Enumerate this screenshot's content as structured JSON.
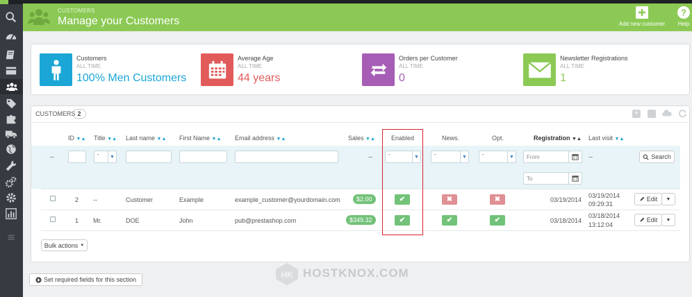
{
  "header": {
    "breadcrumb": "CUSTOMERS",
    "title": "Manage your Customers",
    "add_label": "Add new customer",
    "help_label": "Help"
  },
  "kpis": [
    {
      "label": "Customers",
      "period": "ALL TIME",
      "value": "100% Men Customers",
      "color": "#1ba6d6"
    },
    {
      "label": "Average Age",
      "period": "ALL TIME",
      "value": "44 years",
      "color": "#e15b5b"
    },
    {
      "label": "Orders per Customer",
      "period": "ALL TIME",
      "value": "0",
      "color": "#a55db5"
    },
    {
      "label": "Newsletter Registrations",
      "period": "ALL TIME",
      "value": "1",
      "color": "#8bc954"
    }
  ],
  "list": {
    "title": "CUSTOMERS",
    "count": "2",
    "columns": {
      "id": "ID",
      "title": "Title",
      "last_name": "Last name",
      "first_name": "First Name",
      "email": "Email address",
      "sales": "Sales",
      "enabled": "Enabled",
      "news": "News.",
      "opt": "Opt.",
      "registration": "Registration",
      "last_visit": "Last visit"
    },
    "filters": {
      "dash1": "--",
      "title_value": "-",
      "sales_dash": "--",
      "enabled_value": "-",
      "news_value": "-",
      "opt_value": "-",
      "from_placeholder": "From",
      "to_placeholder": "To",
      "last_visit_dash": "--",
      "search_label": "Search"
    },
    "rows": [
      {
        "id": "2",
        "title": "--",
        "last_name": "Customer",
        "first_name": "Example",
        "email": "example_customer@yourdomain.com",
        "sales": "$2.00",
        "enabled": true,
        "news": false,
        "opt": false,
        "registration": "03/19/2014",
        "last_visit_date": "03/19/2014",
        "last_visit_time": "09:29:31",
        "edit": "Edit"
      },
      {
        "id": "1",
        "title": "Mr.",
        "last_name": "DOE",
        "first_name": "John",
        "email": "pub@prestashop.com",
        "sales": "$349.32",
        "enabled": true,
        "news": true,
        "opt": true,
        "registration": "03/18/2014",
        "last_visit_date": "03/18/2014",
        "last_visit_time": "13:12:04",
        "edit": "Edit"
      }
    ],
    "bulk_label": "Bulk actions"
  },
  "footer_button": "Set required fields for this section",
  "watermark": "HOSTKNOX.COM",
  "colors": {
    "green": "#8bc954",
    "sidebar": "#363a41",
    "highlight": "#d9232d",
    "blue": "#1ba6d6"
  }
}
